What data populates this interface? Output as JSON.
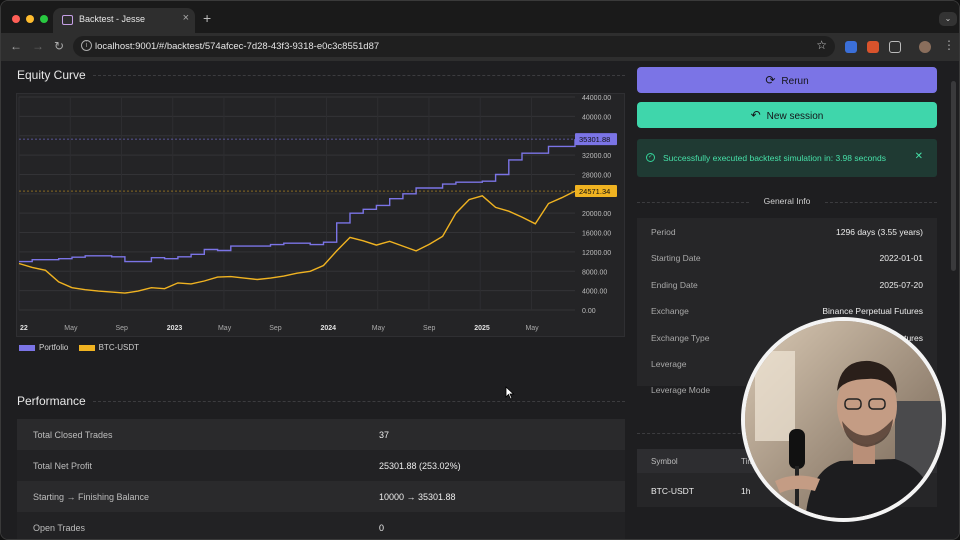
{
  "browser": {
    "tab_title": "Backtest - Jesse",
    "url": "localhost:9001/#/backtest/574afcec-7d28-43f3-9318-e0c3c8551d87"
  },
  "equity": {
    "title": "Equity Curve",
    "legend": [
      {
        "name": "Portfolio",
        "color": "#7b74e6"
      },
      {
        "name": "BTC-USDT",
        "color": "#f0b321"
      }
    ]
  },
  "chart_data": {
    "type": "line",
    "ylim": [
      0,
      44000
    ],
    "y_ticks": [
      "44000.00",
      "40000.00",
      "36000.00",
      "32000.00",
      "28000.00",
      "24000.00",
      "20000.00",
      "16000.00",
      "12000.00",
      "8000.00",
      "4000.00",
      "0.00"
    ],
    "x_ticks": [
      "22",
      "May",
      "Sep",
      "2023",
      "May",
      "Sep",
      "2024",
      "May",
      "Sep",
      "2025",
      "May"
    ],
    "last_values": {
      "Portfolio": "35301.88",
      "BTC-USDT": "24571.34"
    },
    "series": [
      {
        "name": "Portfolio",
        "color": "#7b74e6",
        "values": [
          10000,
          10400,
          10400,
          10600,
          10900,
          11200,
          11200,
          11000,
          10000,
          10000,
          10800,
          10600,
          11000,
          11500,
          12500,
          12300,
          13200,
          13200,
          13200,
          13500,
          13800,
          13800,
          13500,
          14000,
          18000,
          20000,
          20800,
          21600,
          23000,
          24000,
          25200,
          25200,
          26000,
          26400,
          26400,
          26600,
          28000,
          31000,
          32400,
          32400,
          33800,
          33800,
          35301.88
        ]
      },
      {
        "name": "BTC-USDT",
        "color": "#f0b321",
        "values": [
          9600,
          8800,
          8200,
          5800,
          4600,
          4200,
          3900,
          3700,
          3500,
          3900,
          4600,
          4400,
          5600,
          5400,
          6000,
          6800,
          6900,
          6600,
          6300,
          6600,
          7000,
          7600,
          8000,
          9200,
          12200,
          15000,
          14300,
          13400,
          14200,
          13200,
          12200,
          13600,
          15200,
          20000,
          22800,
          23600,
          21200,
          20400,
          19200,
          17800,
          22000,
          23200,
          24571.34
        ]
      }
    ]
  },
  "performance": {
    "title": "Performance",
    "rows": [
      {
        "label": "Total Closed Trades",
        "value": "37"
      },
      {
        "label": "Total Net Profit",
        "value": "25301.88 (253.02%)"
      },
      {
        "label": "Starting → Finishing Balance",
        "value": "10000 → 35301.88"
      },
      {
        "label": "Open Trades",
        "value": "0"
      }
    ]
  },
  "actions": {
    "rerun": "Rerun",
    "rerun_color": "#7b74e6",
    "new_session": "New session",
    "new_session_color": "#3fd6ab"
  },
  "alert": {
    "message": "Successfully executed backtest simulation in: 3.98 seconds"
  },
  "general_info": {
    "title": "General Info",
    "rows": [
      {
        "label": "Period",
        "value": "1296 days (3.55 years)"
      },
      {
        "label": "Starting Date",
        "value": "2022-01-01"
      },
      {
        "label": "Ending Date",
        "value": "2025-07-20"
      },
      {
        "label": "Exchange",
        "value": "Binance Perpetual Futures"
      },
      {
        "label": "Exchange Type",
        "value": "futures"
      },
      {
        "label": "Leverage",
        "value": ""
      },
      {
        "label": "Leverage Mode",
        "value": ""
      }
    ]
  },
  "routes": {
    "headers": [
      "Symbol",
      "Timeframe"
    ],
    "rows": [
      {
        "symbol": "BTC-USDT",
        "timeframe": "1h"
      }
    ]
  }
}
